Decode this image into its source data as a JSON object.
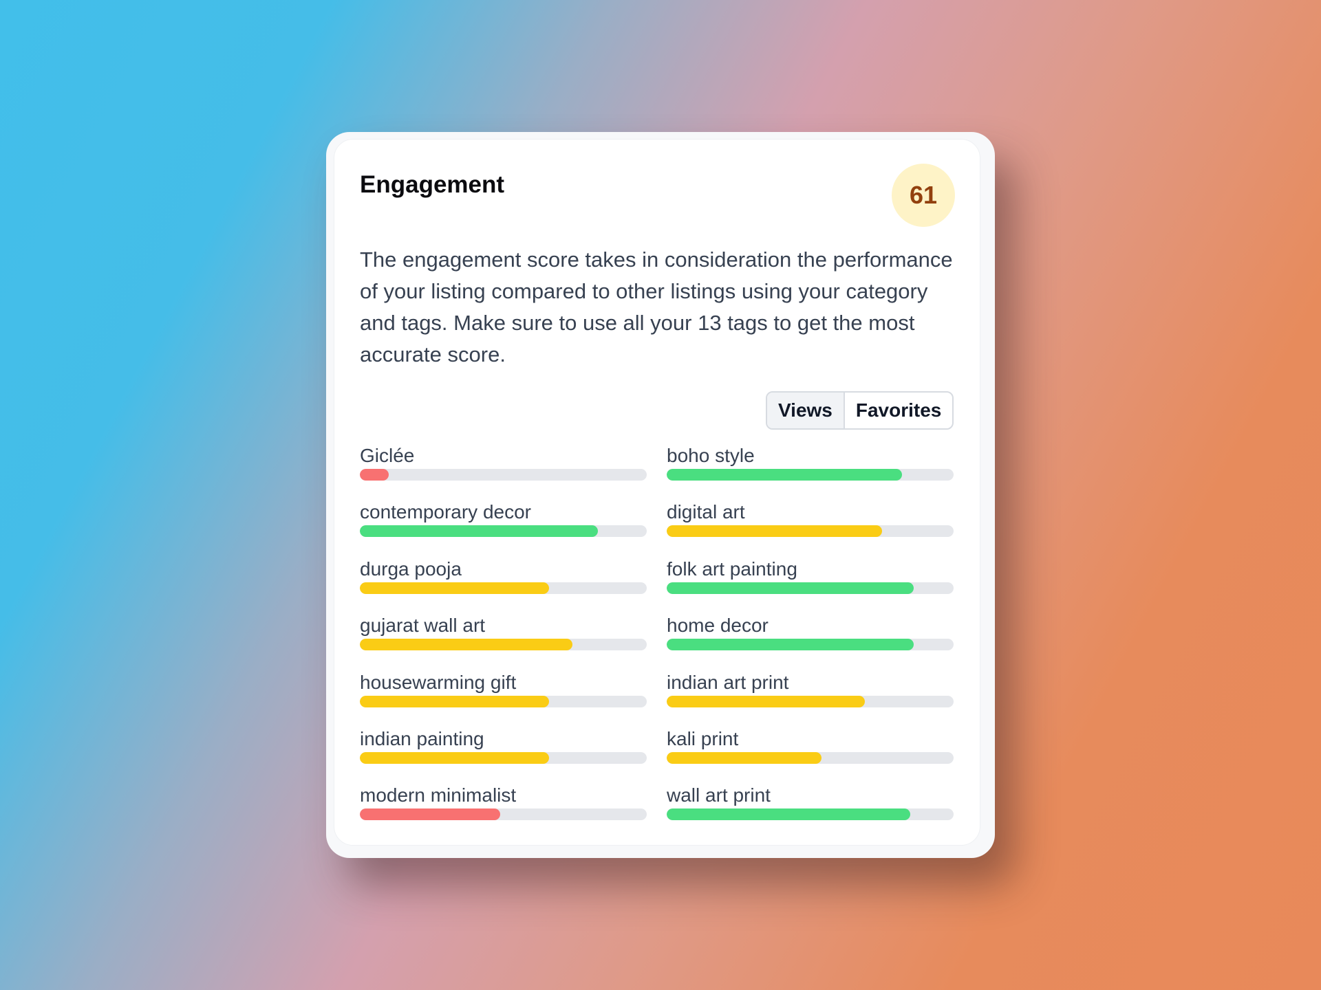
{
  "card": {
    "title": "Engagement",
    "score": "61",
    "description": "The engagement score takes in consideration the performance of your listing compared to other listings using your category and tags. Make sure to use all your 13 tags to get the most accurate score.",
    "toggle": {
      "views": "Views",
      "favorites": "Favorites",
      "selected": "Views"
    }
  },
  "colors": {
    "red": "#f87171",
    "yellow": "#facc15",
    "green": "#4ade80",
    "track": "#e5e7eb",
    "badge_bg": "#fef3c7",
    "badge_text": "#92400e"
  },
  "tags": [
    {
      "label": "Giclée",
      "percent": 10,
      "color": "red"
    },
    {
      "label": "boho style",
      "percent": 82,
      "color": "green"
    },
    {
      "label": "contemporary decor",
      "percent": 83,
      "color": "green"
    },
    {
      "label": "digital art",
      "percent": 75,
      "color": "yellow"
    },
    {
      "label": "durga pooja",
      "percent": 66,
      "color": "yellow"
    },
    {
      "label": "folk art painting",
      "percent": 86,
      "color": "green"
    },
    {
      "label": "gujarat wall art",
      "percent": 74,
      "color": "yellow"
    },
    {
      "label": "home decor",
      "percent": 86,
      "color": "green"
    },
    {
      "label": "housewarming gift",
      "percent": 66,
      "color": "yellow"
    },
    {
      "label": "indian art print",
      "percent": 69,
      "color": "yellow"
    },
    {
      "label": "indian painting",
      "percent": 66,
      "color": "yellow"
    },
    {
      "label": "kali print",
      "percent": 54,
      "color": "yellow"
    },
    {
      "label": "modern minimalist",
      "percent": 49,
      "color": "red"
    },
    {
      "label": "wall art print",
      "percent": 85,
      "color": "green"
    }
  ]
}
